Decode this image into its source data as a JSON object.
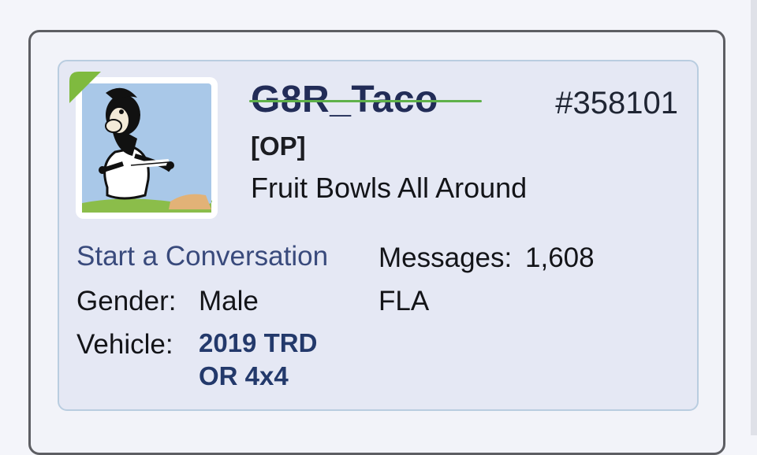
{
  "user": {
    "username": "G8R_Taco",
    "post_number": "#358101",
    "op_badge": "[OP]",
    "title": "Fruit Bowls All Around",
    "online_indicator_color": "#7fba3f"
  },
  "actions": {
    "start_conversation": "Start a Conversation"
  },
  "stats": {
    "messages_label": "Messages:",
    "messages_value": "1,608",
    "gender_label": "Gender:",
    "gender_value": "Male",
    "location": "FLA",
    "vehicle_label": "Vehicle:",
    "vehicle_value": "2019 TRD OR 4x4"
  },
  "colors": {
    "card_background": "#e5e8f4",
    "card_border": "#b9cde0",
    "username": "#222c57",
    "link": "#394a7c",
    "vehicle": "#23396b"
  }
}
